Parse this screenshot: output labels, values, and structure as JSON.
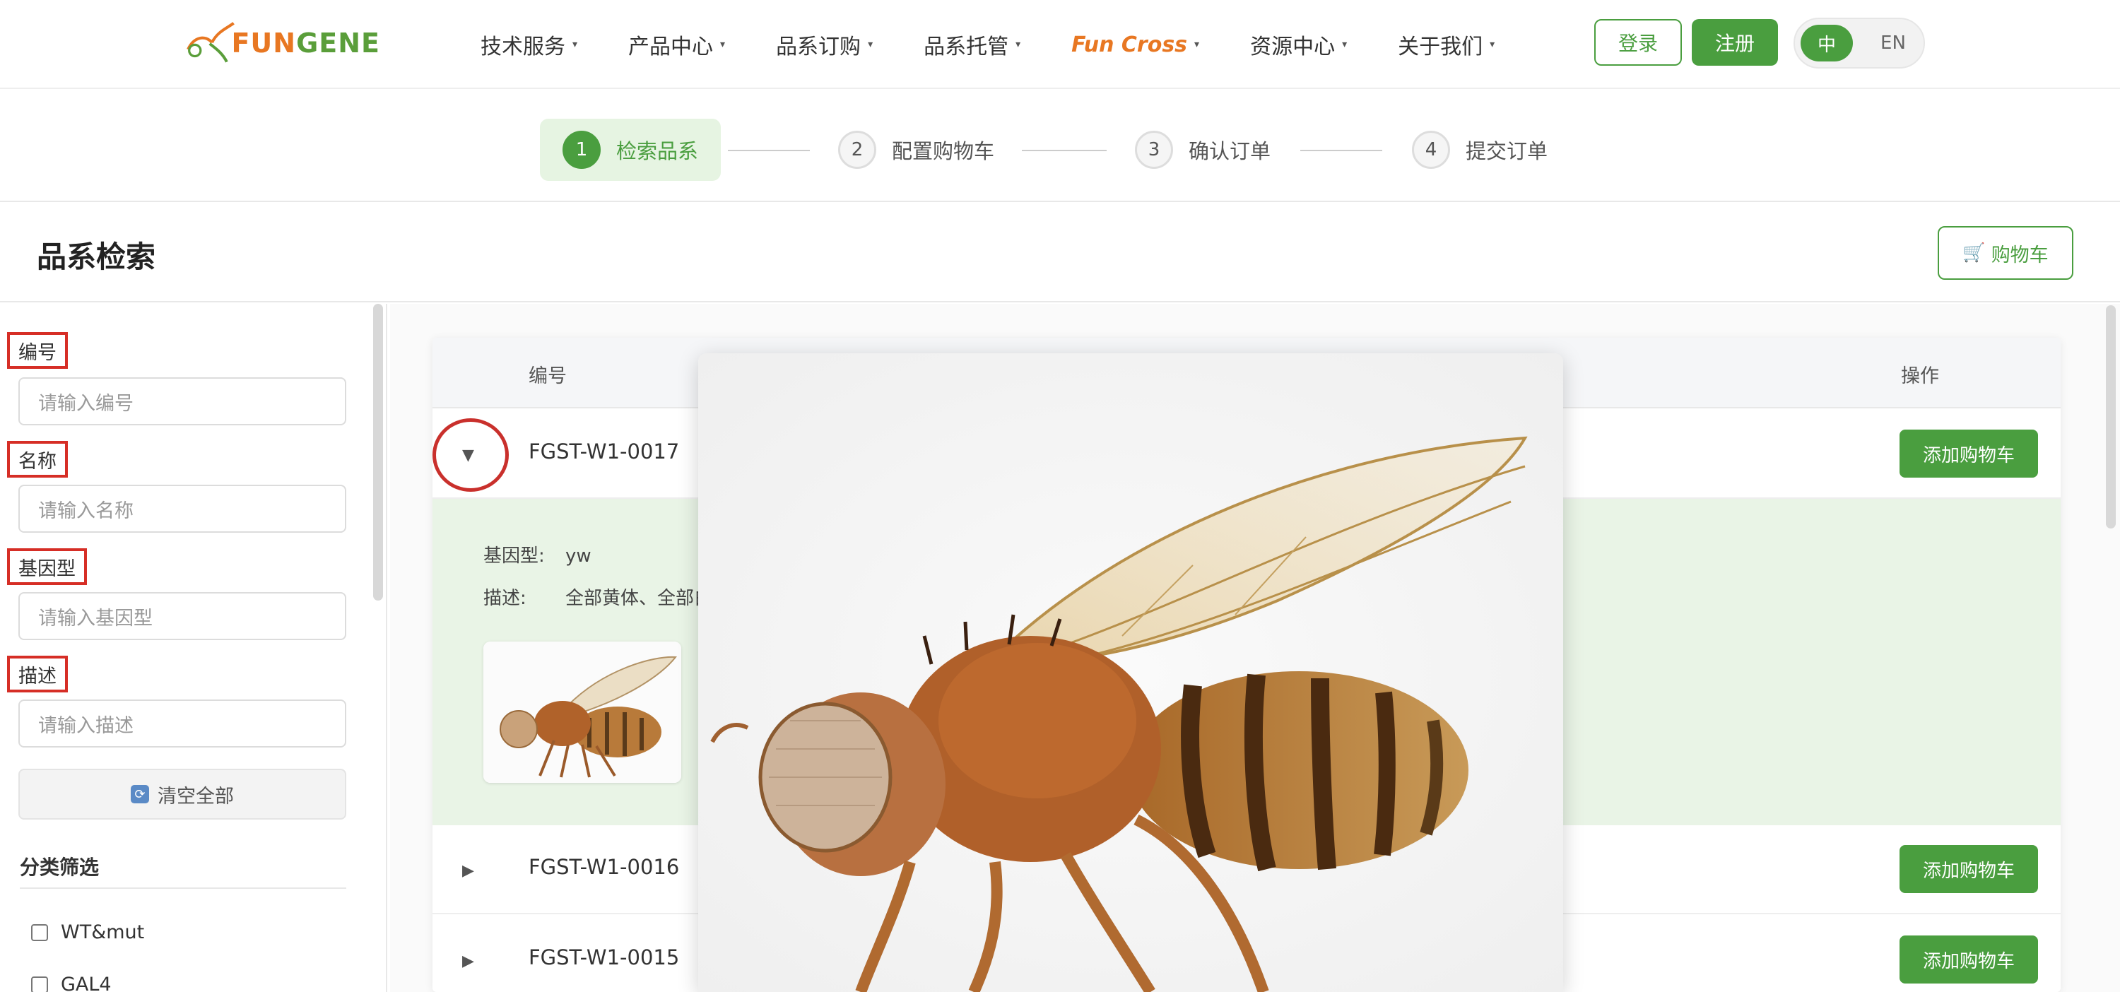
{
  "header": {
    "logo": {
      "part1": "FUN",
      "part2": "GENE"
    },
    "nav": [
      {
        "label": "技术服务",
        "caret": "▾"
      },
      {
        "label": "产品中心",
        "caret": "▾"
      },
      {
        "label": "品系订购",
        "caret": "▾"
      },
      {
        "label": "品系托管",
        "caret": "▾"
      },
      {
        "label": "Fun Cross",
        "caret": "▾"
      },
      {
        "label": "资源中心",
        "caret": "▾"
      },
      {
        "label": "关于我们",
        "caret": "▾"
      }
    ],
    "login_label": "登录",
    "register_label": "注册",
    "lang": {
      "zh": "中",
      "en": "EN",
      "selected": "中"
    }
  },
  "steps": [
    {
      "num": "1",
      "label": "检索品系",
      "active": true
    },
    {
      "num": "2",
      "label": "配置购物车",
      "active": false
    },
    {
      "num": "3",
      "label": "确认订单",
      "active": false
    },
    {
      "num": "4",
      "label": "提交订单",
      "active": false
    }
  ],
  "page": {
    "title": "品系检索",
    "cart_label": "购物车",
    "cart_icon": "🛒"
  },
  "sidebar": {
    "fields": [
      {
        "label": "编号",
        "placeholder": "请输入编号"
      },
      {
        "label": "名称",
        "placeholder": "请输入名称"
      },
      {
        "label": "基因型",
        "placeholder": "请输入基因型"
      },
      {
        "label": "描述",
        "placeholder": "请输入描述"
      }
    ],
    "clear_label": "清空全部",
    "clear_icon": "⟳",
    "filter_title": "分类筛选",
    "filters": [
      {
        "label": "WT&mut",
        "checked": false
      },
      {
        "label": "GAL4",
        "checked": false
      }
    ]
  },
  "table": {
    "headers": {
      "code": "编号",
      "operation": "操作"
    },
    "add_label": "添加购物车",
    "rows": [
      {
        "toggle": "▼",
        "code": "FGST-W1-0017",
        "expanded": true
      },
      {
        "toggle": "▶",
        "code": "FGST-W1-0016",
        "expanded": false
      },
      {
        "toggle": "▶",
        "code": "FGST-W1-0015",
        "expanded": false
      }
    ],
    "detail": {
      "genotype_key": "基因型:",
      "genotype_value": "yw",
      "desc_key": "描述:",
      "desc_value": "全部黄体、全部白"
    }
  },
  "colors": {
    "primary": "#4a9e3f",
    "logo_orange": "#e87722",
    "highlight_red": "#d62e26",
    "expand_bg": "#e9f4e6"
  }
}
